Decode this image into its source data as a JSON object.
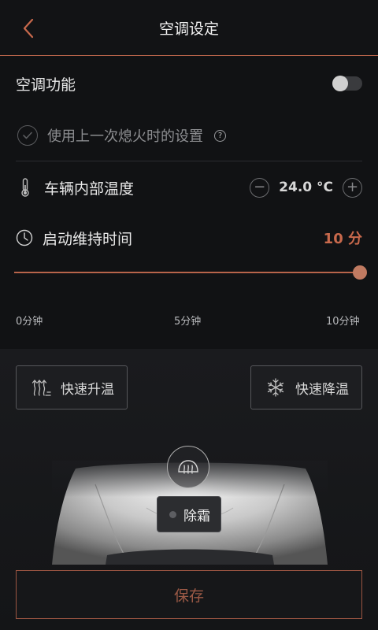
{
  "header": {
    "title": "空调设定"
  },
  "ac": {
    "label": "空调功能",
    "enabled": false
  },
  "last_settings": {
    "label": "使用上一次熄火时的设置",
    "help": "?"
  },
  "temperature": {
    "label": "车辆内部温度",
    "value": "24.0 °C",
    "minus": "−",
    "plus": "+"
  },
  "duration": {
    "label": "启动维持时间",
    "value": "10 分",
    "slider_fraction": 1.0,
    "ticks": [
      "0分钟",
      "5分钟",
      "10分钟"
    ]
  },
  "modes": {
    "heat": "快速升温",
    "cool": "快速降温"
  },
  "defrost": {
    "label": "除霜"
  },
  "save": {
    "label": "保存"
  },
  "colors": {
    "accent": "#c8694c",
    "background": "#111214"
  }
}
